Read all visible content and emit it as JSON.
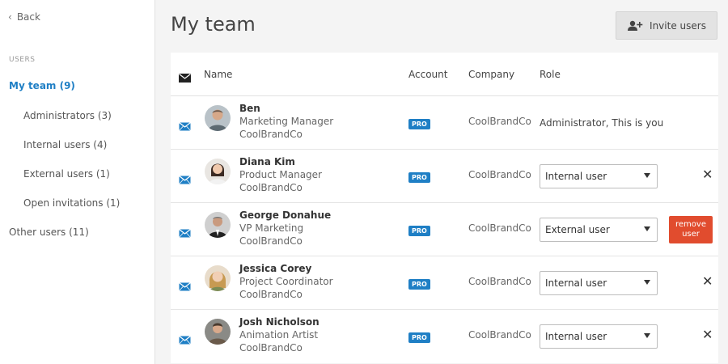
{
  "sidebar": {
    "back_label": "Back",
    "section_label": "USERS",
    "items": [
      {
        "label": "My team (9)"
      },
      {
        "label": "Administrators (3)"
      },
      {
        "label": "Internal users (4)"
      },
      {
        "label": "External users (1)"
      },
      {
        "label": "Open invitations (1)"
      },
      {
        "label": "Other users (11)"
      }
    ]
  },
  "header": {
    "title": "My team",
    "invite_label": "Invite users"
  },
  "table": {
    "columns": [
      "Name",
      "Account",
      "Company",
      "Role"
    ],
    "rows": [
      {
        "name": "Ben",
        "title": "Marketing Manager",
        "org": "CoolBrandCo",
        "account": "PRO",
        "company": "CoolBrandCo",
        "role": "Administrator, This is you"
      },
      {
        "name": "Diana Kim",
        "title": "Product Manager",
        "org": "CoolBrandCo",
        "account": "PRO",
        "company": "CoolBrandCo",
        "role": "Internal user"
      },
      {
        "name": "George Donahue",
        "title": "VP Marketing",
        "org": "CoolBrandCo",
        "account": "PRO",
        "company": "CoolBrandCo",
        "role": "External user",
        "action": "remove user"
      },
      {
        "name": "Jessica Corey",
        "title": "Project Coordinator",
        "org": "CoolBrandCo",
        "account": "PRO",
        "company": "CoolBrandCo",
        "role": "Internal user"
      },
      {
        "name": "Josh Nicholson",
        "title": "Animation Artist",
        "org": "CoolBrandCo",
        "account": "PRO",
        "company": "CoolBrandCo",
        "role": "Internal user"
      }
    ]
  },
  "colors": {
    "accent": "#1f7fc5",
    "danger": "#e14c2e",
    "sidebar_bg": "#ffffff",
    "page_bg": "#f4f4f4"
  },
  "icons": [
    "chevron-left-icon",
    "add-user-icon",
    "envelope-icon",
    "close-icon",
    "chevron-down-icon"
  ]
}
